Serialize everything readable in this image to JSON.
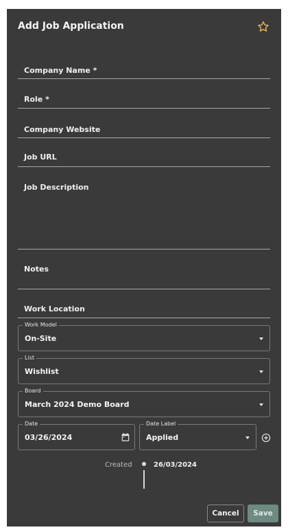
{
  "dialog": {
    "title": "Add Job Application",
    "star_icon": "star-outline-icon"
  },
  "fields": {
    "company_name": "Company Name *",
    "role": "Role *",
    "company_website": "Company Website",
    "job_url": "Job URL",
    "job_description": "Job Description",
    "notes": "Notes",
    "work_location": "Work Location"
  },
  "work_model": {
    "label": "Work Model",
    "value": "On-Site"
  },
  "list": {
    "label": "List",
    "value": "Wishlist"
  },
  "board": {
    "label": "Board",
    "value": "March 2024 Demo Board"
  },
  "date": {
    "label": "Date",
    "value": "03/26/2024"
  },
  "date_label": {
    "label": "Date Label",
    "value": "Applied"
  },
  "timeline": {
    "created_label": "Created",
    "created_date": "26/03/2024"
  },
  "actions": {
    "cancel": "Cancel",
    "save": "Save"
  },
  "colors": {
    "dialog_bg": "#3a3a3a",
    "accent_star": "#e0b060",
    "save_bg": "#6d8a83"
  }
}
